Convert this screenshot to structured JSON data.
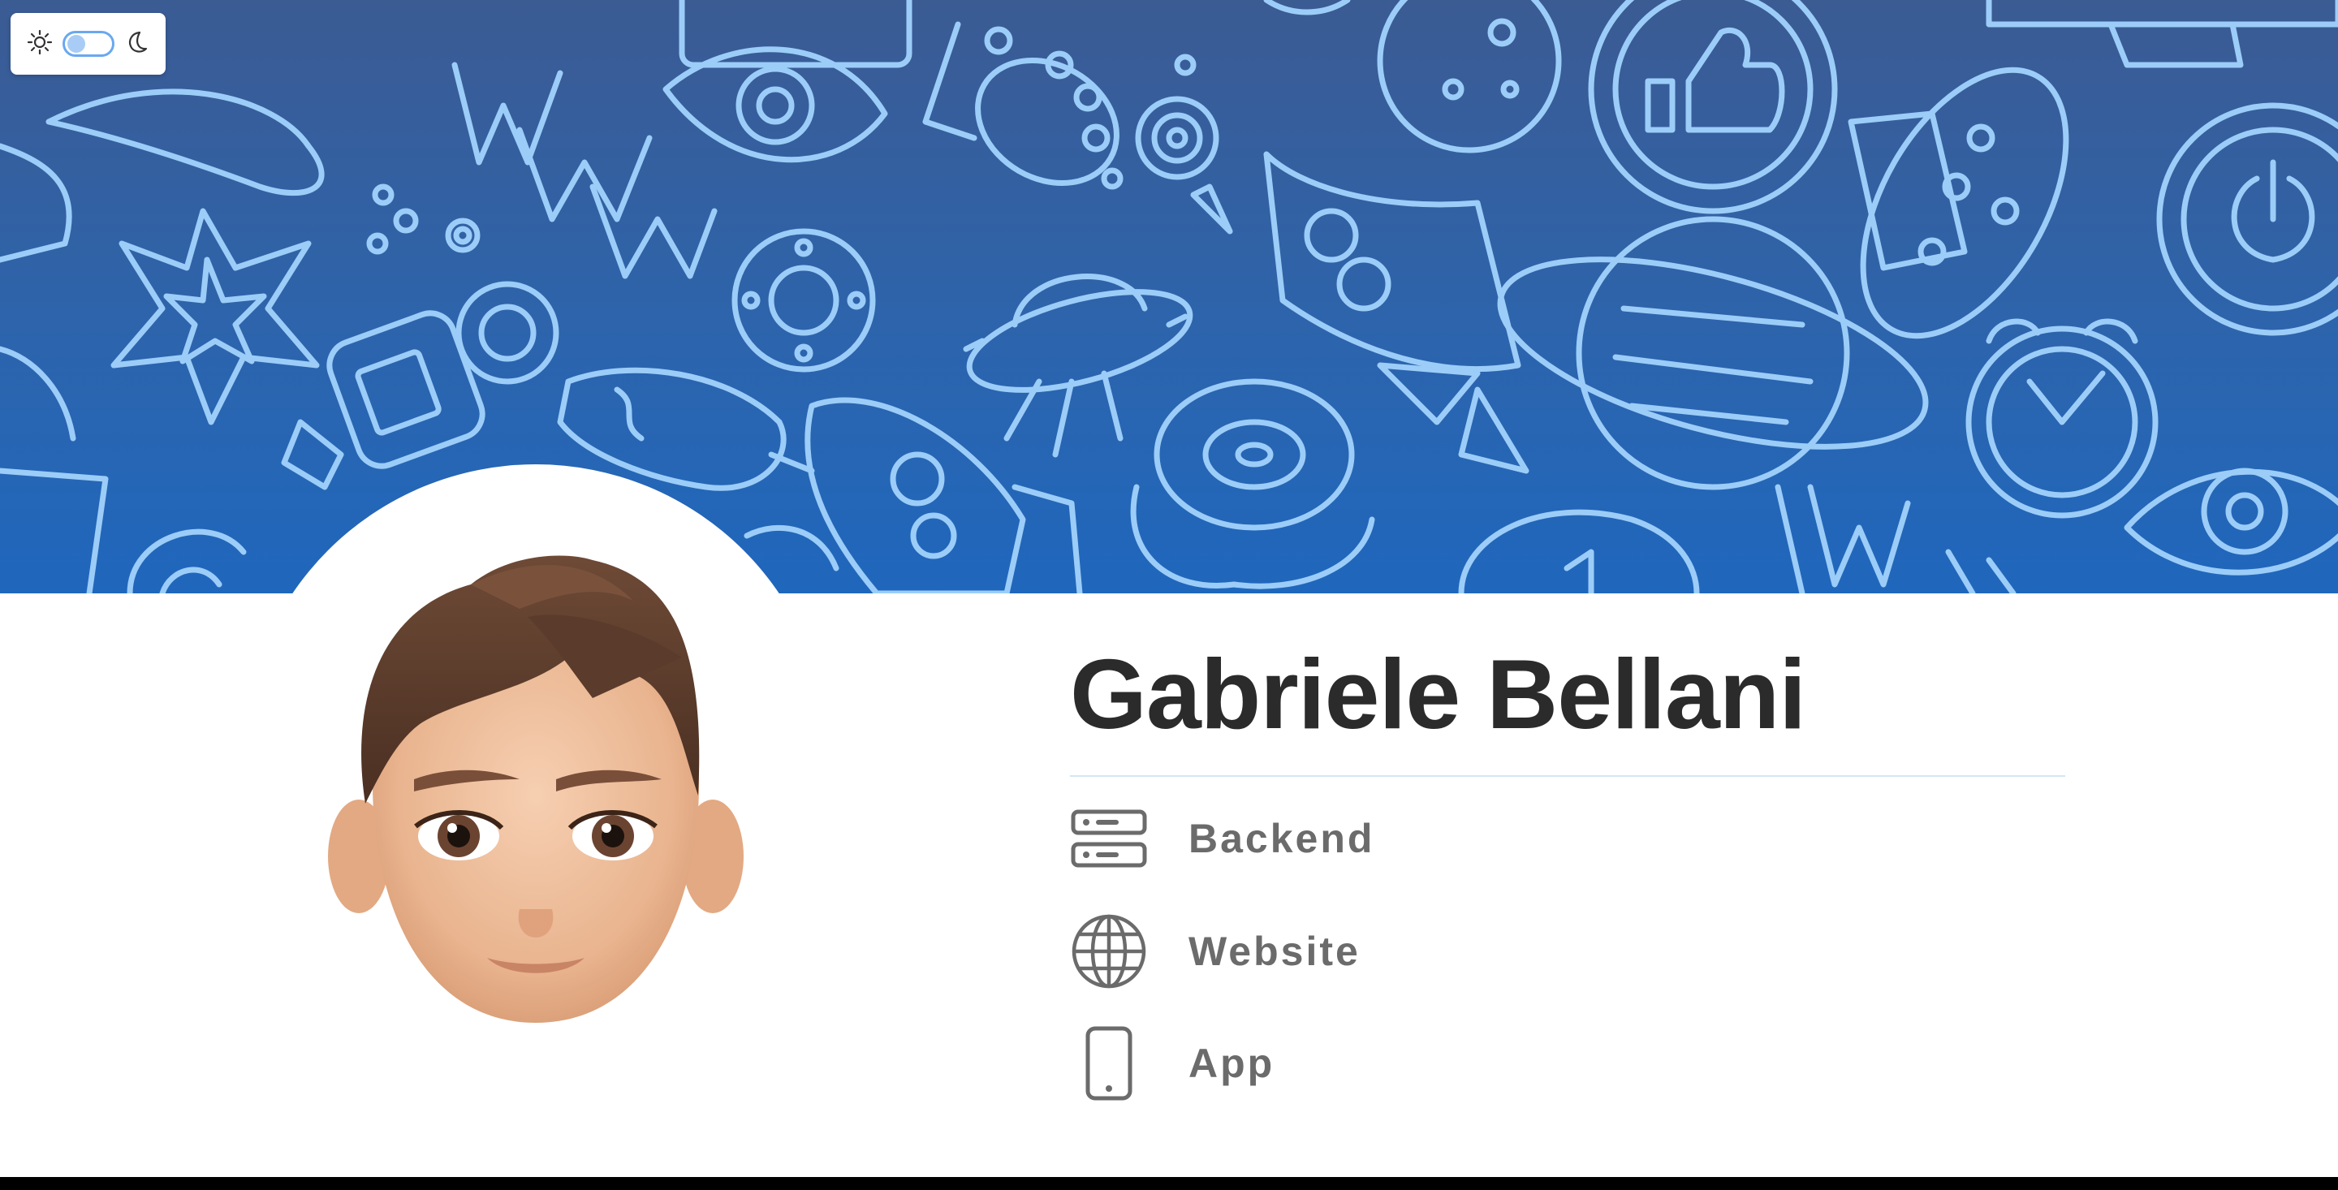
{
  "theme_toggle": {
    "light_icon": "sun-icon",
    "dark_icon": "moon-icon",
    "mode": "light"
  },
  "banner": {
    "pattern": "doodle-space-icons",
    "colors": {
      "top": "#3b5b93",
      "bottom": "#1f67bd",
      "line": "#9ccdf8"
    }
  },
  "profile": {
    "avatar": "memoji-avatar",
    "name": "Gabriele Bellani"
  },
  "links": [
    {
      "icon": "server-icon",
      "label": "Backend"
    },
    {
      "icon": "globe-icon",
      "label": "Website"
    },
    {
      "icon": "smartphone-icon",
      "label": "App"
    }
  ]
}
